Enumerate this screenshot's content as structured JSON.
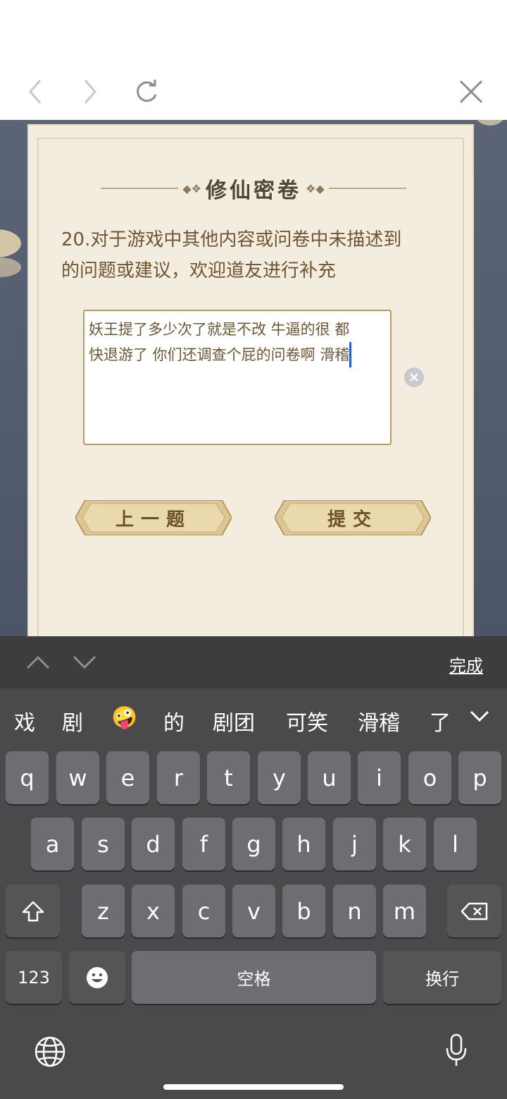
{
  "browser": {
    "back_icon": "chevron-left-icon",
    "forward_icon": "chevron-right-icon",
    "reload_icon": "reload-icon",
    "close_icon": "close-icon"
  },
  "survey": {
    "title": "修仙密卷",
    "question_line1": "20.对于游戏中其他内容或问卷中未描述到",
    "question_line2": "的问题或建议，欢迎道友进行补充",
    "answer_line1": "妖王提了多少次了就是不改 牛逼的很 都",
    "answer_line2": "快退游了 你们还调查个屁的问卷啊 滑稽",
    "prev_label": "上一题",
    "submit_label": "提交"
  },
  "accessory": {
    "done_label": "完成"
  },
  "candidates": [
    "戏",
    "剧",
    "🤪",
    "的",
    "剧团",
    "可笑",
    "滑稽",
    "了"
  ],
  "keyboard": {
    "row1": [
      "q",
      "w",
      "e",
      "r",
      "t",
      "y",
      "u",
      "i",
      "o",
      "p"
    ],
    "row2": [
      "a",
      "s",
      "d",
      "f",
      "g",
      "h",
      "j",
      "k",
      "l"
    ],
    "row3": [
      "z",
      "x",
      "c",
      "v",
      "b",
      "n",
      "m"
    ],
    "numbers_label": "123",
    "space_label": "空格",
    "return_label": "换行"
  }
}
